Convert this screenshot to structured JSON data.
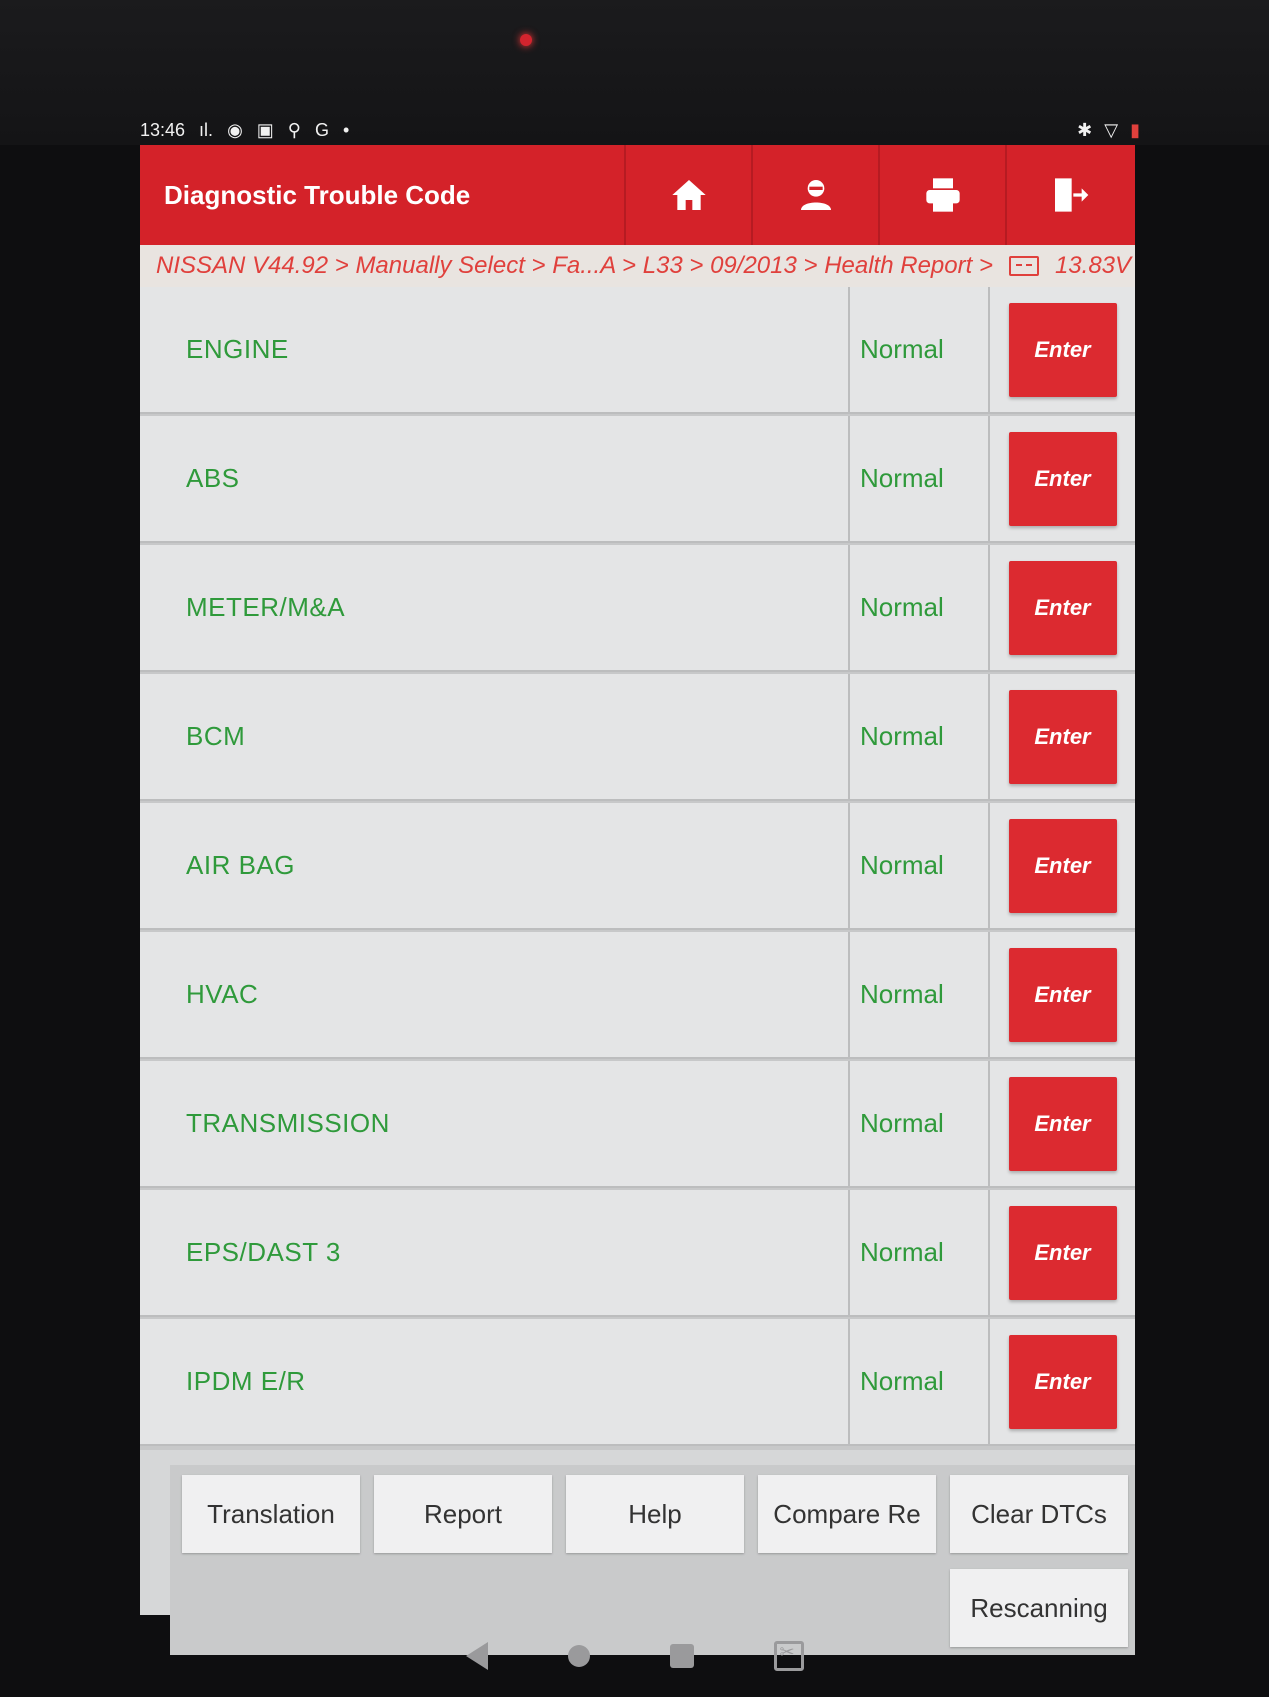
{
  "status_bar": {
    "time": "13:46",
    "signal_text": "ıl.",
    "left_icons": [
      "messenger-icon",
      "facebook-icon",
      "usb-debug-icon",
      "google-icon",
      "dot-icon"
    ],
    "right_icons": [
      "bluetooth-icon",
      "wifi-icon",
      "battery-icon"
    ]
  },
  "header": {
    "title": "Diagnostic Trouble Code",
    "buttons": [
      "home-icon",
      "user-icon",
      "print-icon",
      "exit-icon"
    ]
  },
  "breadcrumb": {
    "path": "NISSAN V44.92 > Manually Select > Fa...A > L33 > 09/2013 > Health Report >",
    "voltage": "13.83V"
  },
  "systems": [
    {
      "name": "ENGINE",
      "status": "Normal",
      "action": "Enter"
    },
    {
      "name": "ABS",
      "status": "Normal",
      "action": "Enter"
    },
    {
      "name": "METER/M&A",
      "status": "Normal",
      "action": "Enter"
    },
    {
      "name": "BCM",
      "status": "Normal",
      "action": "Enter"
    },
    {
      "name": "AIR BAG",
      "status": "Normal",
      "action": "Enter"
    },
    {
      "name": "HVAC",
      "status": "Normal",
      "action": "Enter"
    },
    {
      "name": "TRANSMISSION",
      "status": "Normal",
      "action": "Enter"
    },
    {
      "name": "EPS/DAST 3",
      "status": "Normal",
      "action": "Enter"
    },
    {
      "name": "IPDM E/R",
      "status": "Normal",
      "action": "Enter"
    }
  ],
  "footer": {
    "translation": "Translation",
    "report": "Report",
    "help": "Help",
    "compare": "Compare Re",
    "clear_dtcs": "Clear DTCs",
    "rescanning": "Rescanning"
  },
  "colors": {
    "header_red": "#d42229",
    "status_green": "#2f9a3b",
    "breadcrumb_text": "#e0403c"
  }
}
